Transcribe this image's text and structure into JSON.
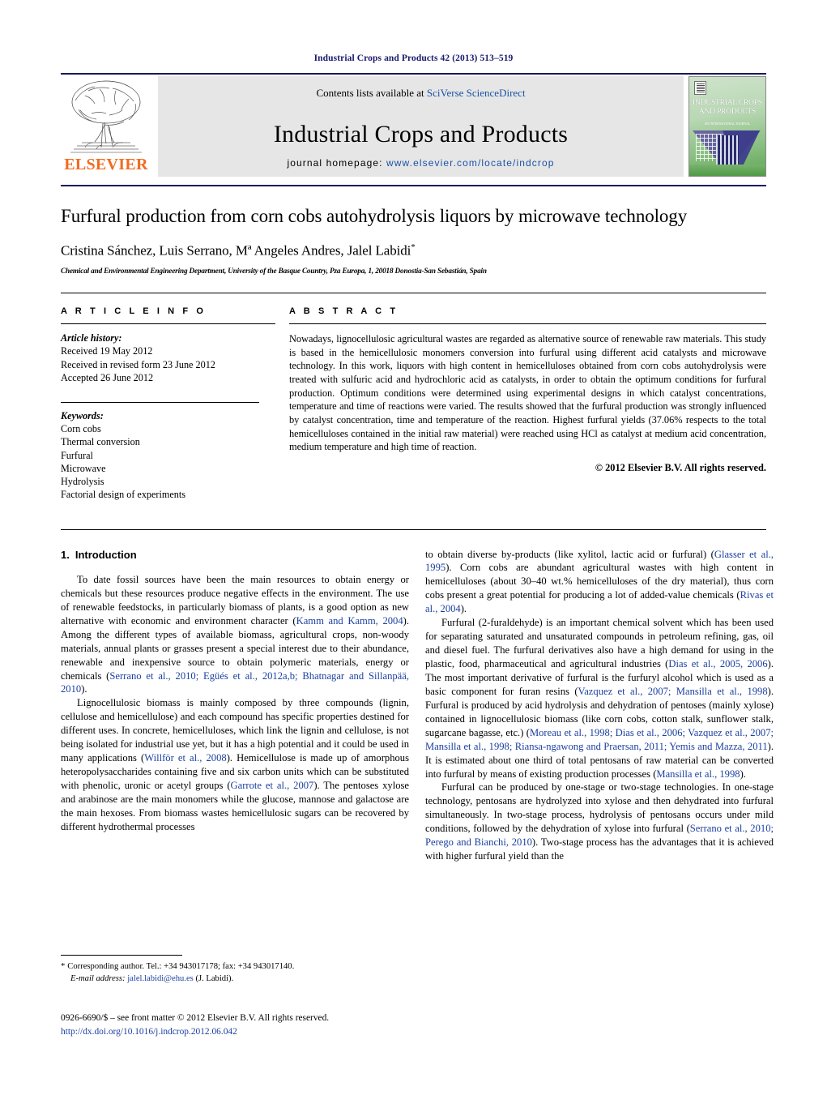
{
  "running_head": "Industrial Crops and Products 42 (2013) 513–519",
  "masthead": {
    "publisher_name": "ELSEVIER",
    "contents_prefix": "Contents lists available at ",
    "contents_link": "SciVerse ScienceDirect",
    "journal_name": "Industrial Crops and Products",
    "homepage_label": "journal homepage:",
    "homepage_url": "www.elsevier.com/locate/indcrop",
    "cover_title_line1": "INDUSTRIAL CROPS",
    "cover_title_line2": "AND PRODUCTS",
    "cover_subtitle": "AN INTERNATIONAL JOURNAL"
  },
  "article": {
    "title": "Furfural production from corn cobs autohydrolysis liquors by microwave technology",
    "authors": "Cristina Sánchez, Luis Serrano, Mª Angeles Andres, Jalel Labidi",
    "corresponding_marker": "*",
    "affiliation": "Chemical and Environmental Engineering Department, University of the Basque Country, Pza Europa, 1, 20018 Donostia-San Sebastián, Spain"
  },
  "article_info": {
    "heading": "A R T I C L E   I N F O",
    "history_label": "Article history:",
    "history": [
      "Received 19 May 2012",
      "Received in revised form 23 June 2012",
      "Accepted 26 June 2012"
    ],
    "keywords_label": "Keywords:",
    "keywords": [
      "Corn cobs",
      "Thermal conversion",
      "Furfural",
      "Microwave",
      "Hydrolysis",
      "Factorial design of experiments"
    ]
  },
  "abstract": {
    "heading": "A B S T R A C T",
    "text": "Nowadays, lignocellulosic agricultural wastes are regarded as alternative source of renewable raw materials. This study is based in the hemicellulosic monomers conversion into furfural using different acid catalysts and microwave technology. In this work, liquors with high content in hemicelluloses obtained from corn cobs autohydrolysis were treated with sulfuric acid and hydrochloric acid as catalysts, in order to obtain the optimum conditions for furfural production. Optimum conditions were determined using experimental designs in which catalyst concentrations, temperature and time of reactions were varied. The results showed that the furfural production was strongly influenced by catalyst concentration, time and temperature of the reaction. Highest furfural yields (37.06% respects to the total hemicelluloses contained in the initial raw material) were reached using HCl as catalyst at medium acid concentration, medium temperature and high time of reaction.",
    "copyright": "© 2012 Elsevier B.V. All rights reserved."
  },
  "introduction": {
    "number": "1.",
    "title": "Introduction",
    "left_paragraphs": [
      {
        "segments": [
          {
            "t": "To date fossil sources have been the main resources to obtain energy or chemicals but these resources produce negative effects in the environment. The use of renewable feedstocks, in particularly biomass of plants, is a good option as new alternative with economic and environment character (",
            "ref": false
          },
          {
            "t": "Kamm and Kamm, 2004",
            "ref": true
          },
          {
            "t": "). Among the different types of available biomass, agricultural crops, non-woody materials, annual plants or grasses present a special interest due to their abundance, renewable and inexpensive source to obtain polymeric materials, energy or chemicals (",
            "ref": false
          },
          {
            "t": "Serrano et al., 2010; Egüés et al., 2012a,b; Bhatnagar and Sillanpää, 2010",
            "ref": true
          },
          {
            "t": ").",
            "ref": false
          }
        ]
      },
      {
        "segments": [
          {
            "t": "Lignocellulosic biomass is mainly composed by three compounds (lignin, cellulose and hemicellulose) and each compound has specific properties destined for different uses. In concrete, hemicelluloses, which link the lignin and cellulose, is not being isolated for industrial use yet, but it has a high potential and it could be used in many applications (",
            "ref": false
          },
          {
            "t": "Willför et al., 2008",
            "ref": true
          },
          {
            "t": "). Hemicellulose is made up of amorphous heteropolysaccharides containing five and six carbon units which can be substituted with phenolic, uronic or acetyl groups (",
            "ref": false
          },
          {
            "t": "Garrote et al., 2007",
            "ref": true
          },
          {
            "t": "). The pentoses xylose and arabinose are the main monomers while the glucose, mannose and galactose are the main hexoses. From biomass wastes hemicellulosic sugars can be recovered by different hydrothermal processes",
            "ref": false
          }
        ]
      }
    ],
    "right_paragraphs": [
      {
        "no_indent": true,
        "segments": [
          {
            "t": "to obtain diverse by-products (like xylitol, lactic acid or furfural) (",
            "ref": false
          },
          {
            "t": "Glasser et al., 1995",
            "ref": true
          },
          {
            "t": "). Corn cobs are abundant agricultural wastes with high content in hemicelluloses (about 30–40 wt.% hemicelluloses of the dry material), thus corn cobs present a great potential for producing a lot of added-value chemicals (",
            "ref": false
          },
          {
            "t": "Rivas et al., 2004",
            "ref": true
          },
          {
            "t": ").",
            "ref": false
          }
        ]
      },
      {
        "segments": [
          {
            "t": "Furfural (2-furaldehyde) is an important chemical solvent which has been used for separating saturated and unsaturated compounds in petroleum refining, gas, oil and diesel fuel. The furfural derivatives also have a high demand for using in the plastic, food, pharmaceutical and agricultural industries (",
            "ref": false
          },
          {
            "t": "Dias et al., 2005, 2006",
            "ref": true
          },
          {
            "t": "). The most important derivative of furfural is the furfuryl alcohol which is used as a basic component for furan resins (",
            "ref": false
          },
          {
            "t": "Vazquez et al., 2007; Mansilla et al., 1998",
            "ref": true
          },
          {
            "t": "). Furfural is produced by acid hydrolysis and dehydration of pentoses (mainly xylose) contained in lignocellulosic biomass (like corn cobs, cotton stalk, sunflower stalk, sugarcane bagasse, etc.) (",
            "ref": false
          },
          {
            "t": "Moreau et al., 1998; Dias et al., 2006; Vazquez et al., 2007; Mansilla et al., 1998; Riansa-ngawong and Praersan, 2011; Yemis and Mazza, 2011",
            "ref": true
          },
          {
            "t": "). It is estimated about one third of total pentosans of raw material can be converted into furfural by means of existing production processes (",
            "ref": false
          },
          {
            "t": "Mansilla et al., 1998",
            "ref": true
          },
          {
            "t": ").",
            "ref": false
          }
        ]
      },
      {
        "segments": [
          {
            "t": "Furfural can be produced by one-stage or two-stage technologies. In one-stage technology, pentosans are hydrolyzed into xylose and then dehydrated into furfural simultaneously. In two-stage process, hydrolysis of pentosans occurs under mild conditions, followed by the dehydration of xylose into furfural (",
            "ref": false
          },
          {
            "t": "Serrano et al., 2010; Perego and Bianchi, 2010",
            "ref": true
          },
          {
            "t": "). Two-stage process has the advantages that it is achieved with higher furfural yield than the",
            "ref": false
          }
        ]
      }
    ]
  },
  "footnote": {
    "star": "*",
    "corresponding": "Corresponding author. Tel.: +34 943017178; fax: +34 943017140.",
    "email_label": "E-mail address:",
    "email": "jalel.labidi@ehu.es",
    "email_owner": "(J. Labidi)."
  },
  "footer": {
    "issn_line": "0926-6690/$ – see front matter © 2012 Elsevier B.V. All rights reserved.",
    "doi": "http://dx.doi.org/10.1016/j.indcrop.2012.06.042"
  }
}
